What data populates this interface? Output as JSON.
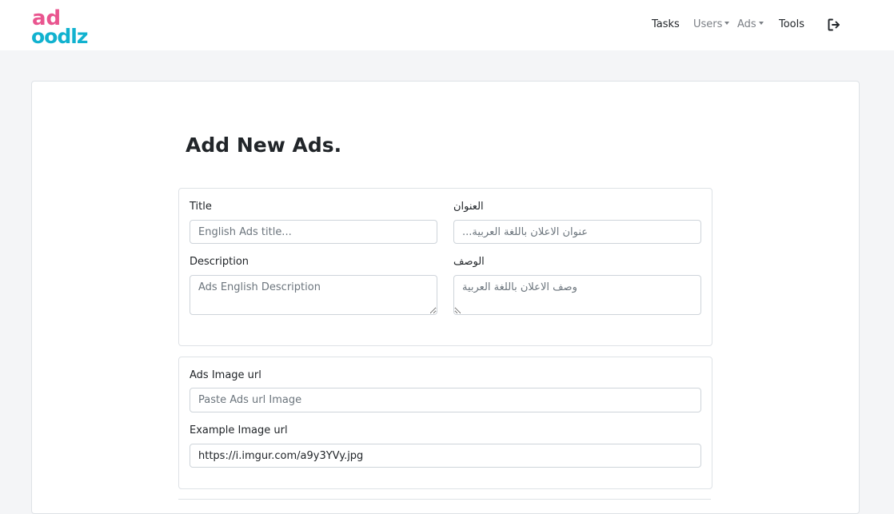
{
  "brand": {
    "logo_top": "ad",
    "logo_bottom": "oodlz",
    "colors": {
      "pink": "#e9558f",
      "cyan": "#11b2cf"
    }
  },
  "nav": {
    "tasks": "Tasks",
    "users": "Users",
    "ads": "Ads",
    "tools": "Tools",
    "logout_icon": "logout-icon"
  },
  "page": {
    "title": "Add New Ads."
  },
  "form": {
    "title_en": {
      "label": "Title",
      "placeholder": "English Ads title..."
    },
    "title_ar": {
      "label": "العنوان",
      "placeholder": "عنوان الاعلان باللغة العربية..."
    },
    "desc_en": {
      "label": "Description",
      "placeholder": "Ads English Description"
    },
    "desc_ar": {
      "label": "الوصف",
      "placeholder": "وصف الاعلان باللغة العربية"
    },
    "image_url": {
      "label": "Ads Image url",
      "placeholder": "Paste Ads url Image"
    },
    "example_url": {
      "label": "Example Image url",
      "value": "https://i.imgur.com/a9y3YVy.jpg"
    }
  }
}
